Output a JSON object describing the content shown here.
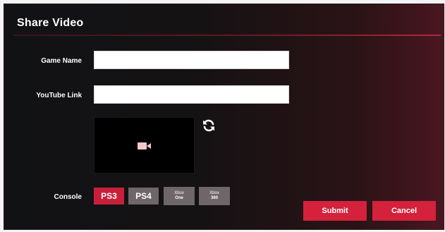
{
  "dialog": {
    "title": "Share Video"
  },
  "form": {
    "game_name_label": "Game Name",
    "game_name_value": "",
    "youtube_link_label": "YouTube Link",
    "youtube_link_value": "",
    "console_label": "Console"
  },
  "preview": {
    "icon": "video-camera-icon",
    "refresh_icon": "refresh-icon"
  },
  "consoles": {
    "ps3": "PS3",
    "ps4": "PS4",
    "xbox_one_line1": "Xbox",
    "xbox_one_line2": "One",
    "xbox_360_line1": "Xbox",
    "xbox_360_line2": "360",
    "selected": "PS3"
  },
  "actions": {
    "submit": "Submit",
    "cancel": "Cancel"
  },
  "colors": {
    "accent": "#d4213c",
    "selected_console": "#c8203a",
    "unselected_console": "#6e6668"
  }
}
